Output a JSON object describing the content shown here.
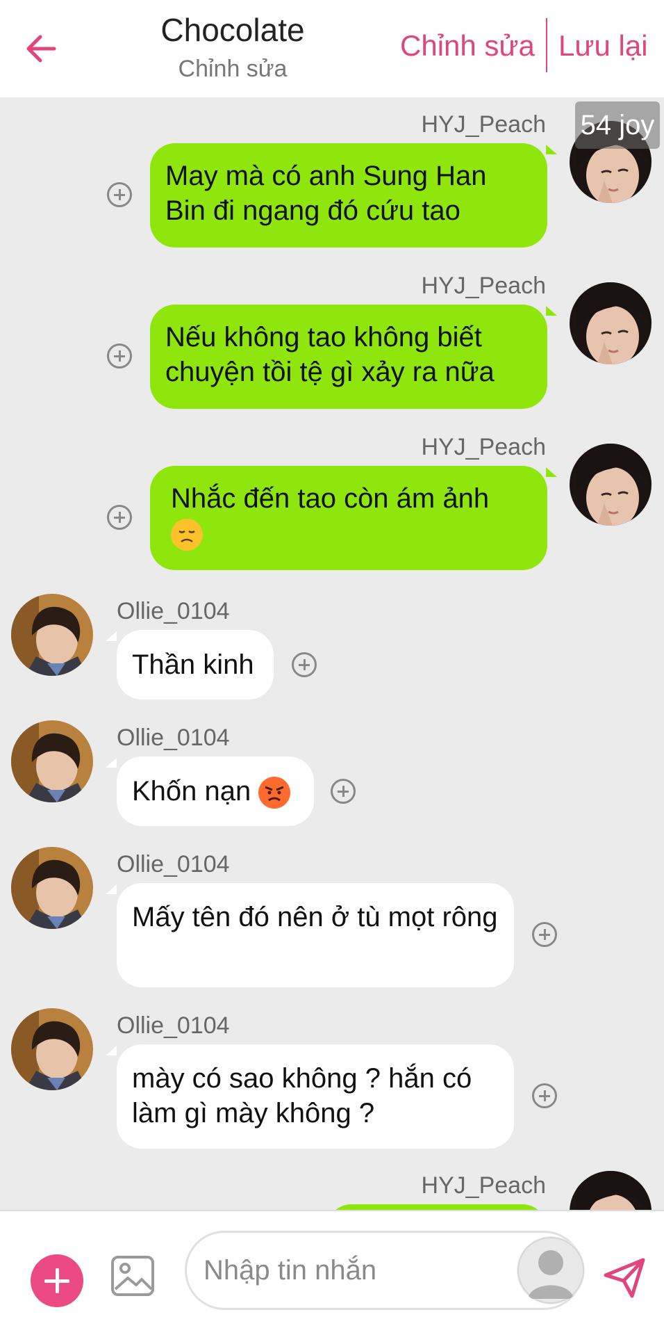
{
  "header": {
    "title": "Chocolate",
    "subtitle": "Chỉnh sửa",
    "edit_label": "Chỉnh sửa",
    "save_label": "Lưu lại"
  },
  "badge": "54 joy",
  "messages": [
    {
      "sender": "HYJ_Peach",
      "side": "right",
      "text": "May mà có anh Sung Han Bin đi ngang đó cứu tao"
    },
    {
      "sender": "HYJ_Peach",
      "side": "right",
      "text": "Nếu không tao không biết chuyện tồi tệ gì xảy ra nữa"
    },
    {
      "sender": "HYJ_Peach",
      "side": "right",
      "text": "Nhắc đến tao còn ám ảnh",
      "emoji": "disappointed-face"
    },
    {
      "sender": "Ollie_0104",
      "side": "left",
      "text": "Thần kinh"
    },
    {
      "sender": "Ollie_0104",
      "side": "left",
      "text": "Khốn nạn",
      "emoji": "angry-face"
    },
    {
      "sender": "Ollie_0104",
      "side": "left",
      "text": "Mấy tên đó nên ở tù mọt rông"
    },
    {
      "sender": "Ollie_0104",
      "side": "left",
      "text": "mày có sao không ? hắn có làm gì mày không ?"
    },
    {
      "sender": "HYJ_Peach",
      "side": "right",
      "text": ""
    }
  ],
  "input": {
    "placeholder": "Nhập tin nhắn"
  },
  "colors": {
    "accent": "#e0457b",
    "green_bubble": "#8fe60c",
    "white_bubble": "#ffffff",
    "background": "#ebebeb"
  },
  "icons": {
    "back": "arrow-left-icon",
    "add": "plus-icon",
    "image": "image-icon",
    "send": "send-icon",
    "bubble_action": "plus-circle-icon"
  }
}
